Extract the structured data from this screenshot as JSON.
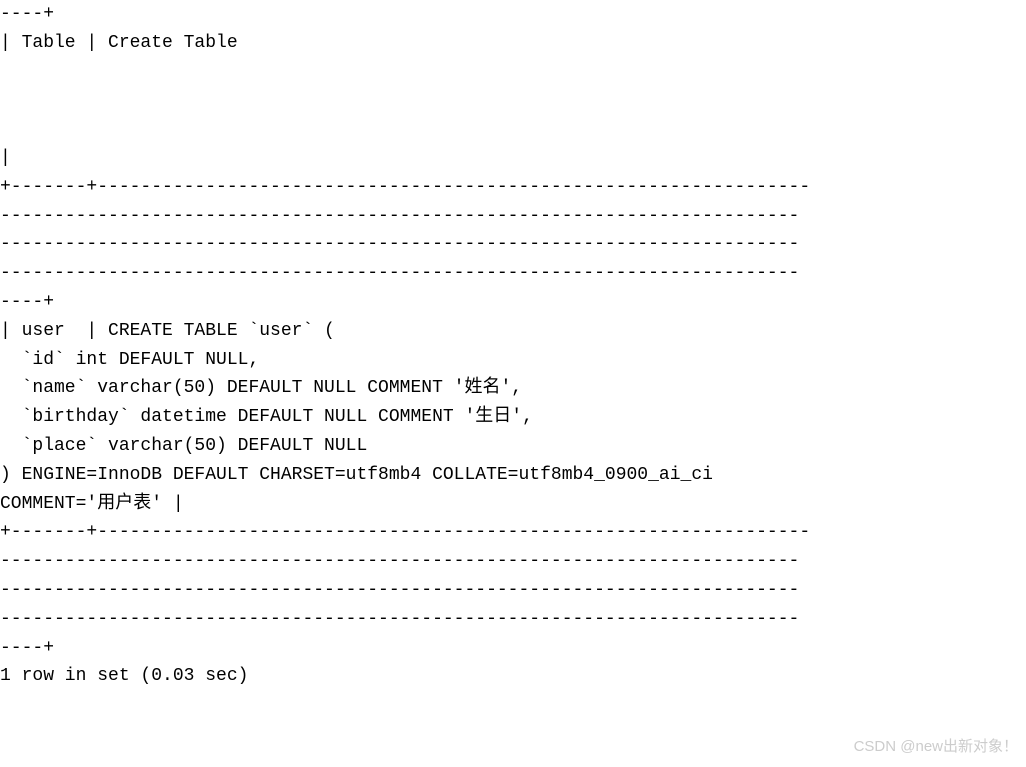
{
  "terminal": {
    "lines": [
      "----+",
      "| Table | Create Table                                                   ",
      "                                                                          ",
      "                                                                          ",
      "                                                                          ",
      "|",
      "+-------+------------------------------------------------------------------",
      "--------------------------------------------------------------------------",
      "--------------------------------------------------------------------------",
      "--------------------------------------------------------------------------",
      "----+",
      "| user  | CREATE TABLE `user` (",
      "  `id` int DEFAULT NULL,",
      "  `name` varchar(50) DEFAULT NULL COMMENT '姓名',",
      "  `birthday` datetime DEFAULT NULL COMMENT '生日',",
      "  `place` varchar(50) DEFAULT NULL",
      ") ENGINE=InnoDB DEFAULT CHARSET=utf8mb4 COLLATE=utf8mb4_0900_ai_ci ",
      "COMMENT='用户表' |",
      "+-------+------------------------------------------------------------------",
      "--------------------------------------------------------------------------",
      "--------------------------------------------------------------------------",
      "--------------------------------------------------------------------------",
      "----+",
      "1 row in set (0.03 sec)"
    ]
  },
  "watermark": {
    "text": "CSDN @new出新对象！"
  }
}
